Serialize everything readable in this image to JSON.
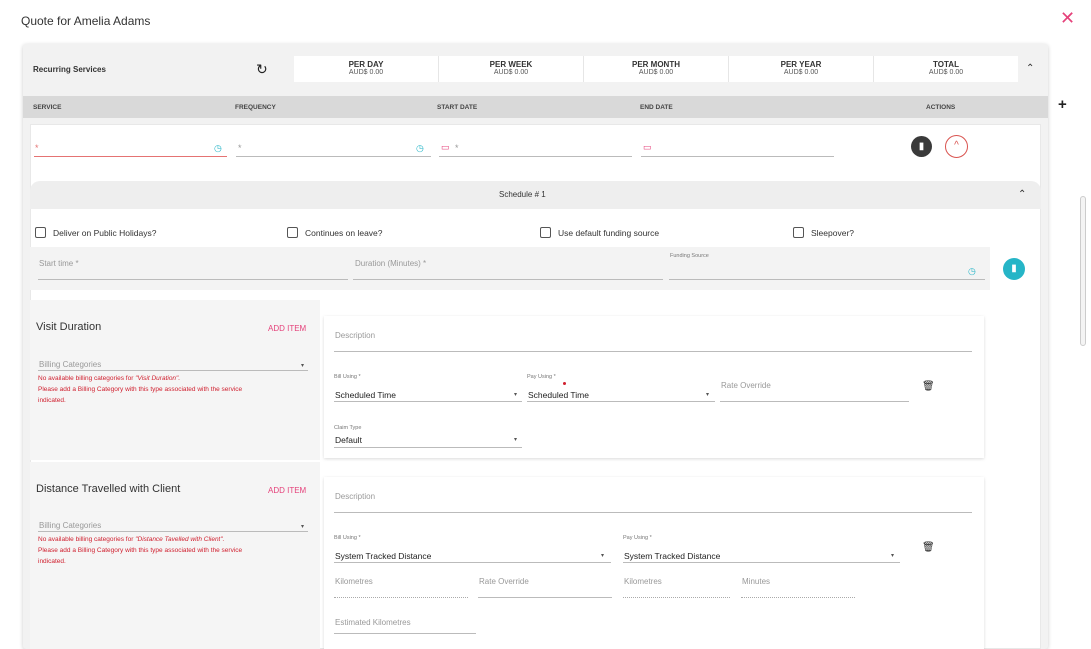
{
  "dialog": {
    "title": "Quote for Amelia Adams"
  },
  "recurring": {
    "label": "Recurring Services",
    "totals": [
      {
        "heading": "PER DAY",
        "value": "AUD$ 0.00"
      },
      {
        "heading": "PER WEEK",
        "value": "AUD$ 0.00"
      },
      {
        "heading": "PER MONTH",
        "value": "AUD$ 0.00"
      },
      {
        "heading": "PER YEAR",
        "value": "AUD$ 0.00"
      },
      {
        "heading": "TOTAL",
        "value": "AUD$ 0.00"
      }
    ],
    "columns": {
      "service": "SERVICE",
      "frequency": "FREQUENCY",
      "start_date": "START DATE",
      "end_date": "END DATE",
      "actions": "ACTIONS"
    },
    "required_mark": "*"
  },
  "schedule": {
    "title": "Schedule # 1",
    "checkboxes": [
      {
        "label": "Deliver on Public Holidays?",
        "checked": false
      },
      {
        "label": "Continues on leave?",
        "checked": false
      },
      {
        "label": "Use default funding source",
        "checked": false
      },
      {
        "label": "Sleepover?",
        "checked": false
      }
    ],
    "start_time_placeholder": "Start time *",
    "duration_placeholder": "Duration (Minutes) *",
    "funding_source_label": "Funding Source"
  },
  "visit": {
    "title": "Visit Duration",
    "add_item": "ADD ITEM",
    "billing_placeholder": "Billing Categories",
    "err_prefix": "No available billing categories for ",
    "err_name": "\"Visit Duration\".",
    "err_line2": "Please add a Billing Category with this type associated with the service",
    "err_line3": "indicated.",
    "description_placeholder": "Description",
    "bill_using_label": "Bill Using *",
    "bill_using_value": "Scheduled Time",
    "pay_using_label": "Pay Using *",
    "pay_using_value": "Scheduled Time",
    "rate_override_placeholder": "Rate Override",
    "claim_type_label": "Claim Type",
    "claim_type_value": "Default"
  },
  "distance": {
    "title": "Distance Travelled with Client",
    "add_item": "ADD ITEM",
    "billing_placeholder": "Billing Categories",
    "err_prefix": "No available billing categories for ",
    "err_name": "\"Distance Tavelled with Client\".",
    "err_line2": "Please add a Billing Category with this type associated with the service",
    "err_line3": "indicated.",
    "description_placeholder": "Description",
    "bill_using_label": "Bill Using *",
    "bill_using_value": "System Tracked Distance",
    "pay_using_label": "Pay Using *",
    "pay_using_value": "System Tracked Distance",
    "kilometres_placeholder": "Kilometres",
    "rate_override_placeholder": "Rate Override",
    "kilometres2_placeholder": "Kilometres",
    "minutes_placeholder": "Minutes",
    "estimated_km_placeholder": "Estimated Kilometres"
  },
  "colors": {
    "accent_pink": "#e5417a",
    "error_red": "#d0202f",
    "teal": "#26b5c7"
  }
}
